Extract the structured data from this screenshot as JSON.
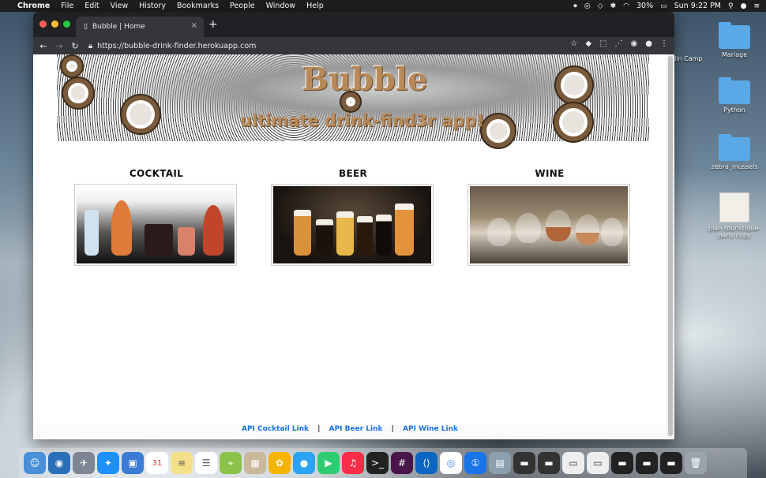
{
  "menubar": {
    "app_name": "Chrome",
    "items": [
      "File",
      "Edit",
      "View",
      "History",
      "Bookmarks",
      "People",
      "Window",
      "Help"
    ],
    "battery": "30%",
    "clock": "Sun 9:22 PM"
  },
  "desktop": {
    "icons": [
      {
        "label": "Mariage"
      },
      {
        "label": "Python"
      },
      {
        "label": "zebra_mussels"
      },
      {
        "label": "plan-touristique-paris copy"
      },
      {
        "label": "y_Codin Camp"
      }
    ]
  },
  "browser": {
    "tab_title": "Bubble | Home",
    "url": "https://bubble-drink-finder.herokuapp.com"
  },
  "page": {
    "title": "Bubble",
    "subtitle": "ultimate drink-find3r app!",
    "categories": [
      {
        "label": "COCKTAIL"
      },
      {
        "label": "BEER"
      },
      {
        "label": "WINE"
      }
    ],
    "footer_links": [
      "API Cocktail Link",
      "API Beer Link",
      "API Wine Link"
    ],
    "footer_separator": "|"
  },
  "colors": {
    "title_brown": "#b88a5a",
    "link_blue": "#1a73e8"
  }
}
